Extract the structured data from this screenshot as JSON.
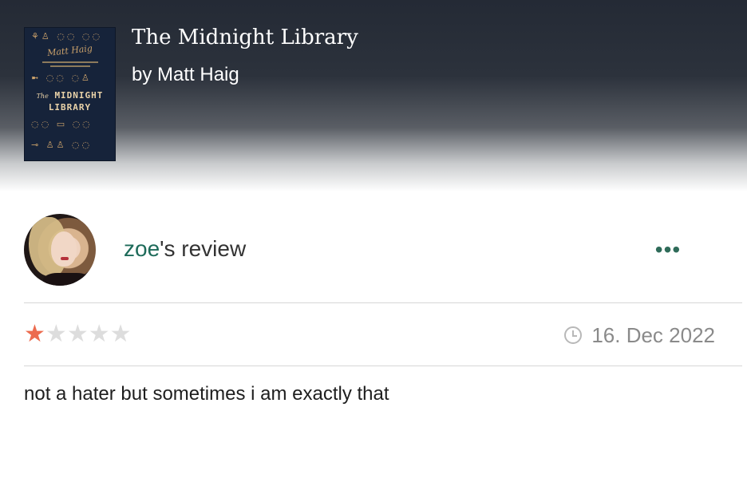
{
  "book": {
    "title": "The Midnight Library",
    "author_line": "by Matt Haig",
    "cover": {
      "author": "Matt Haig",
      "title_prefix": "The",
      "title_line1": "MIDNIGHT",
      "title_line2": "LIBRARY"
    }
  },
  "review": {
    "username": "zoe",
    "heading_suffix": "'s review",
    "more_label": "•••",
    "rating": 1,
    "rating_max": 5,
    "date": "16. Dec 2022",
    "text": "not a hater but sometimes i am exactly that"
  },
  "colors": {
    "accent_green": "#1e6b5a",
    "star_filled": "#ec6b4e",
    "star_empty": "#dddddd"
  },
  "icons": {
    "more": "more-options-icon",
    "clock": "clock-icon",
    "star": "star-icon"
  }
}
